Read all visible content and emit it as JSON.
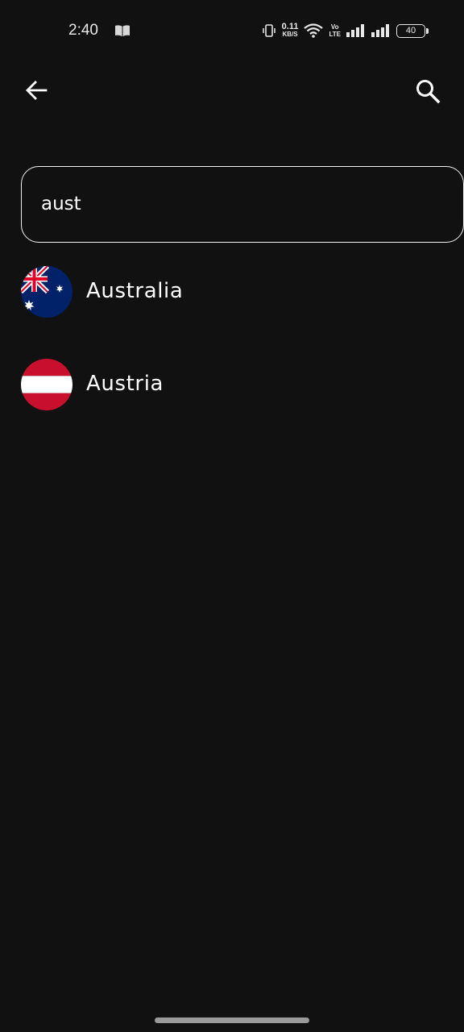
{
  "status_bar": {
    "time": "2:40",
    "net_speed_value": "0.11",
    "net_speed_unit": "KB/S",
    "volte_top": "Vo",
    "volte_bottom": "LTE",
    "battery_level": "40"
  },
  "app_bar": {
    "back_icon": "arrow-left-icon",
    "search_icon": "search-icon"
  },
  "search": {
    "value": "aust"
  },
  "countries": [
    {
      "name": "Australia",
      "flag_icon": "australia-flag-icon"
    },
    {
      "name": "Austria",
      "flag_icon": "austria-flag-icon"
    }
  ],
  "colors": {
    "background": "#111111",
    "text": "#ffffff",
    "australia_blue": "#012169",
    "australia_red": "#E4002B",
    "austria_red": "#C8102E"
  }
}
